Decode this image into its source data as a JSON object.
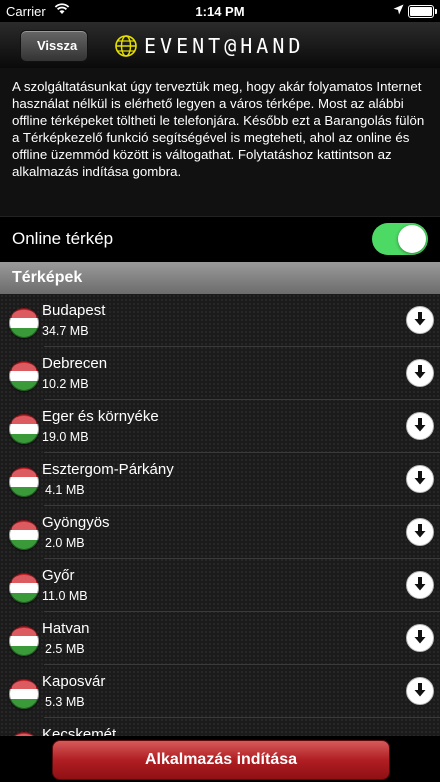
{
  "status_bar": {
    "carrier": "Carrier",
    "time": "1:14 PM"
  },
  "nav": {
    "back_label": "Vissza",
    "logo_text": "EVENT@HAND"
  },
  "intro_text": "A szolgáltatásunkat úgy terveztük meg, hogy akár folyamatos Internet használat nélkül is elérhető legyen a város térképe. Most az alábbi offline térképeket töltheti le telefonjára. Később ezt a Barangolás fülön a Térképkezelő funkció segítségével is megteheti, ahol az online és offline üzemmód között is váltogathat. Folytatáshoz kattintson az alkalmazás indítása gombra.",
  "online_map": {
    "label": "Online térkép",
    "enabled": true,
    "on_color": "#4cd964"
  },
  "section_title": "Térképek",
  "maps": [
    {
      "name": "Budapest",
      "size": "34.7 MB"
    },
    {
      "name": "Debrecen",
      "size": "10.2 MB"
    },
    {
      "name": "Eger és környéke",
      "size": "19.0 MB"
    },
    {
      "name": "Esztergom-Párkány",
      "size": "4.1 MB"
    },
    {
      "name": "Gyöngyös",
      "size": "2.0 MB"
    },
    {
      "name": "Győr",
      "size": "11.0 MB"
    },
    {
      "name": "Hatvan",
      "size": "2.5 MB"
    },
    {
      "name": "Kaposvár",
      "size": "5.3 MB"
    },
    {
      "name": "Kecskemét",
      "size": ""
    }
  ],
  "launch_button": "Alkalmazás indítása",
  "colors": {
    "launch": "#b01e22",
    "flag_red": "#d0242d",
    "flag_green": "#3a9a3a"
  }
}
